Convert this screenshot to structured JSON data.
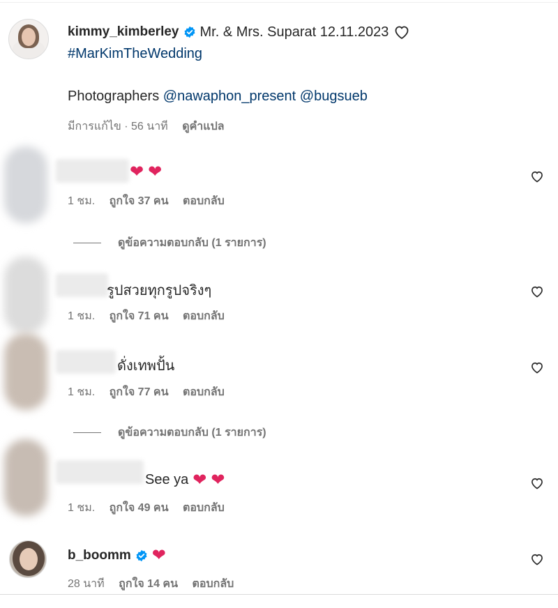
{
  "caption": {
    "username": "kimmy_kimberley",
    "text": "Mr. & Mrs. Suparat 12.11.2023",
    "hashtag": "#MarKimTheWedding",
    "photographers_label": "Photographers",
    "mention1": "@nawaphon_present",
    "mention2": "@bugsueb",
    "edited": "มีการแก้ไข · 56 นาที",
    "see_translation": "ดูคำแปล"
  },
  "comments": [
    {
      "text": "",
      "time": "1 ชม.",
      "likes": "ถูกใจ 37 คน",
      "reply": "ตอบกลับ",
      "view_replies": "ดูข้อความตอบกลับ (1 รายการ)"
    },
    {
      "text": "รูปสวยทุกรูปจริงๆ",
      "time": "1 ชม.",
      "likes": "ถูกใจ 71 คน",
      "reply": "ตอบกลับ"
    },
    {
      "text": "ดั่งเทพปั้น",
      "time": "1 ชม.",
      "likes": "ถูกใจ 77 คน",
      "reply": "ตอบกลับ",
      "view_replies": "ดูข้อความตอบกลับ (1 รายการ)"
    },
    {
      "text": "See ya",
      "time": "1 ชม.",
      "likes": "ถูกใจ 49 คน",
      "reply": "ตอบกลับ"
    },
    {
      "username": "b_boomm",
      "time": "28 นาที",
      "likes": "ถูกใจ 14 คน",
      "reply": "ตอบกลับ"
    }
  ],
  "colors": {
    "heart": "#e0245e",
    "link": "#00376b",
    "verified": "#0095f6",
    "muted": "#737373"
  },
  "icons": [
    "verified-badge-icon",
    "heart-outline-icon",
    "red-heart-emoji"
  ]
}
